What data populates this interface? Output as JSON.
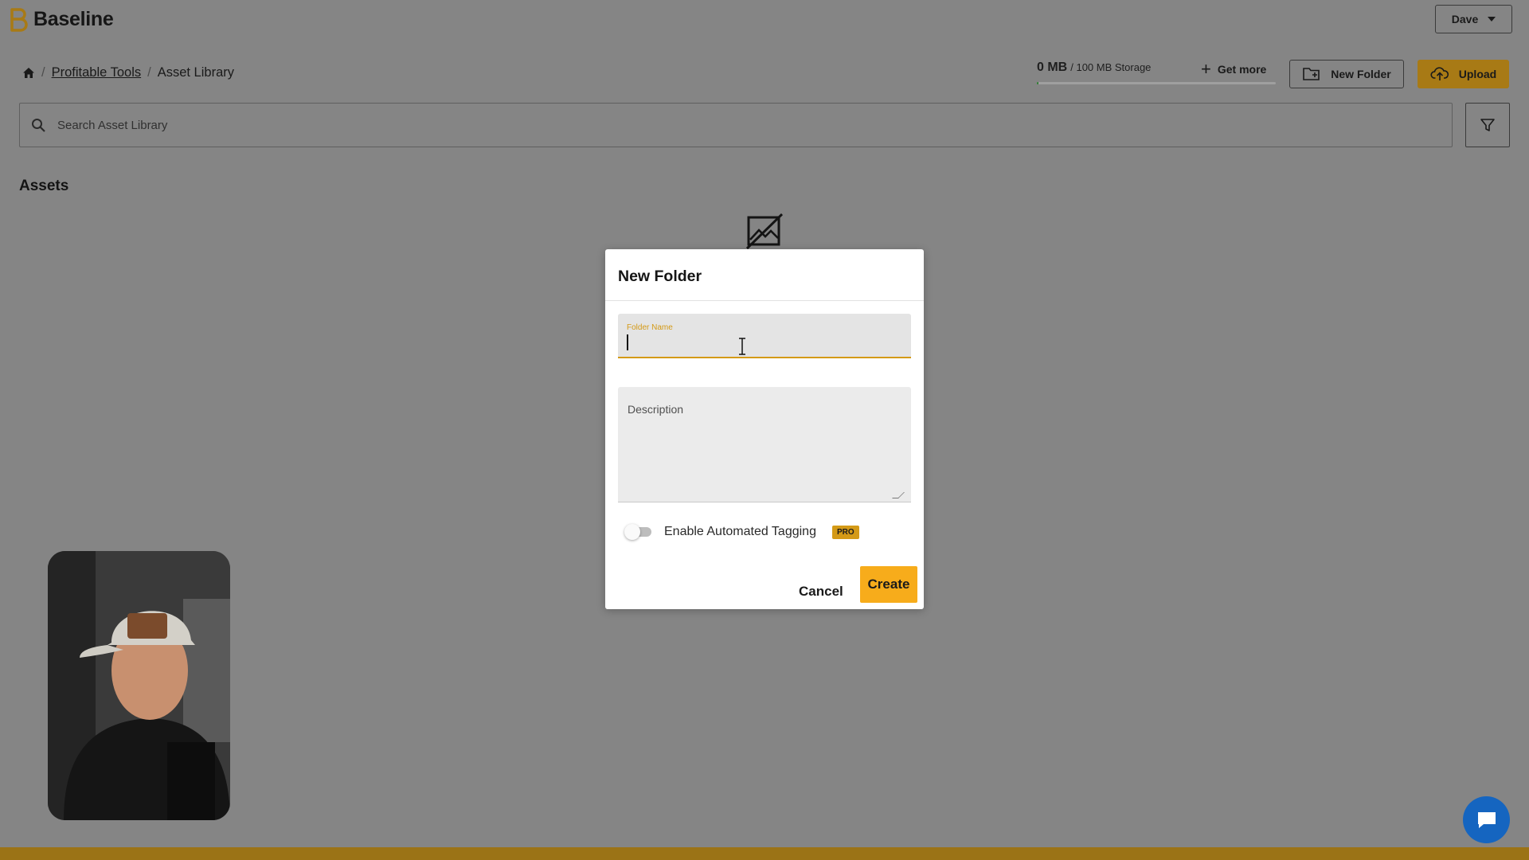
{
  "header": {
    "app_name": "Baseline",
    "user_name": "Dave"
  },
  "breadcrumb": {
    "items": [
      "Profitable Tools",
      "Asset Library"
    ],
    "separator": "/"
  },
  "storage": {
    "used": "0 MB",
    "total": "/ 100 MB Storage",
    "used_fraction": 0.0
  },
  "toolbar": {
    "get_more_label": "Get more",
    "new_folder_label": "New Folder",
    "upload_label": "Upload"
  },
  "search": {
    "placeholder": "Search Asset Library"
  },
  "section": {
    "assets_title": "Assets"
  },
  "modal": {
    "title": "New Folder",
    "folder_name_label": "Folder Name",
    "folder_name_value": "",
    "description_placeholder": "Description",
    "toggle_label": "Enable Automated Tagging",
    "toggle_on": false,
    "pro_badge": "PRO",
    "cancel_label": "Cancel",
    "create_label": "Create"
  },
  "colors": {
    "accent": "#f7ac1b",
    "accent_dim": "#a87a15",
    "overlay_bg": "#858585",
    "chat_blue": "#1565c0"
  },
  "icons": [
    "home-icon",
    "search-icon",
    "filter-icon",
    "new-folder-icon",
    "upload-cloud-icon",
    "plus-icon",
    "no-image-icon",
    "chat-icon",
    "chevron-down-icon"
  ]
}
